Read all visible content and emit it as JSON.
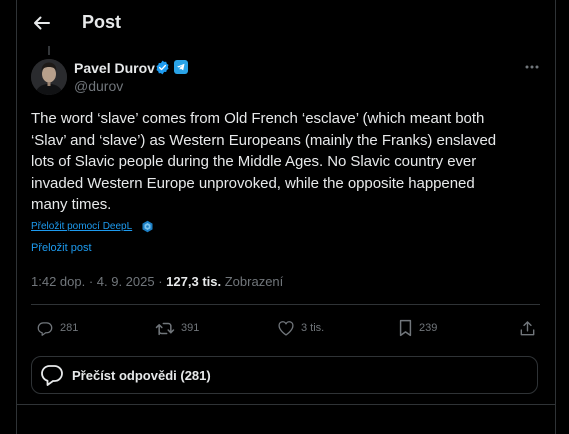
{
  "header": {
    "title": "Post"
  },
  "author": {
    "name": "Pavel Durov",
    "handle": "@durov"
  },
  "post": {
    "lines": [
      "The word ‘slave’ comes from Old French ‘esclave’ (which meant both",
      "‘Slav’ and ‘slave’) as Western Europeans (mainly the Franks) enslaved",
      "lots of Slavic people during the Middle Ages. No Slavic country ever",
      "invaded Western Europe unprovoked, while the opposite happened",
      "many times."
    ],
    "deepl_link": "Přeložit pomocí DeepL",
    "translate_link": "Přeložit post",
    "timestamp": "1:42 dop. · 4. 9. 2025 ·",
    "views_count": "127,3 tis.",
    "views_label": "Zobrazení"
  },
  "actions": {
    "replies": "281",
    "reposts": "391",
    "likes": "3 tis.",
    "bookmarks": "239"
  },
  "read_replies": "Přečíst odpovědi (281)",
  "colors": {
    "accent": "#1d9bf0",
    "verified": "#1d9bf0",
    "telegram": "#2aa3e6",
    "muted": "#71767b"
  }
}
